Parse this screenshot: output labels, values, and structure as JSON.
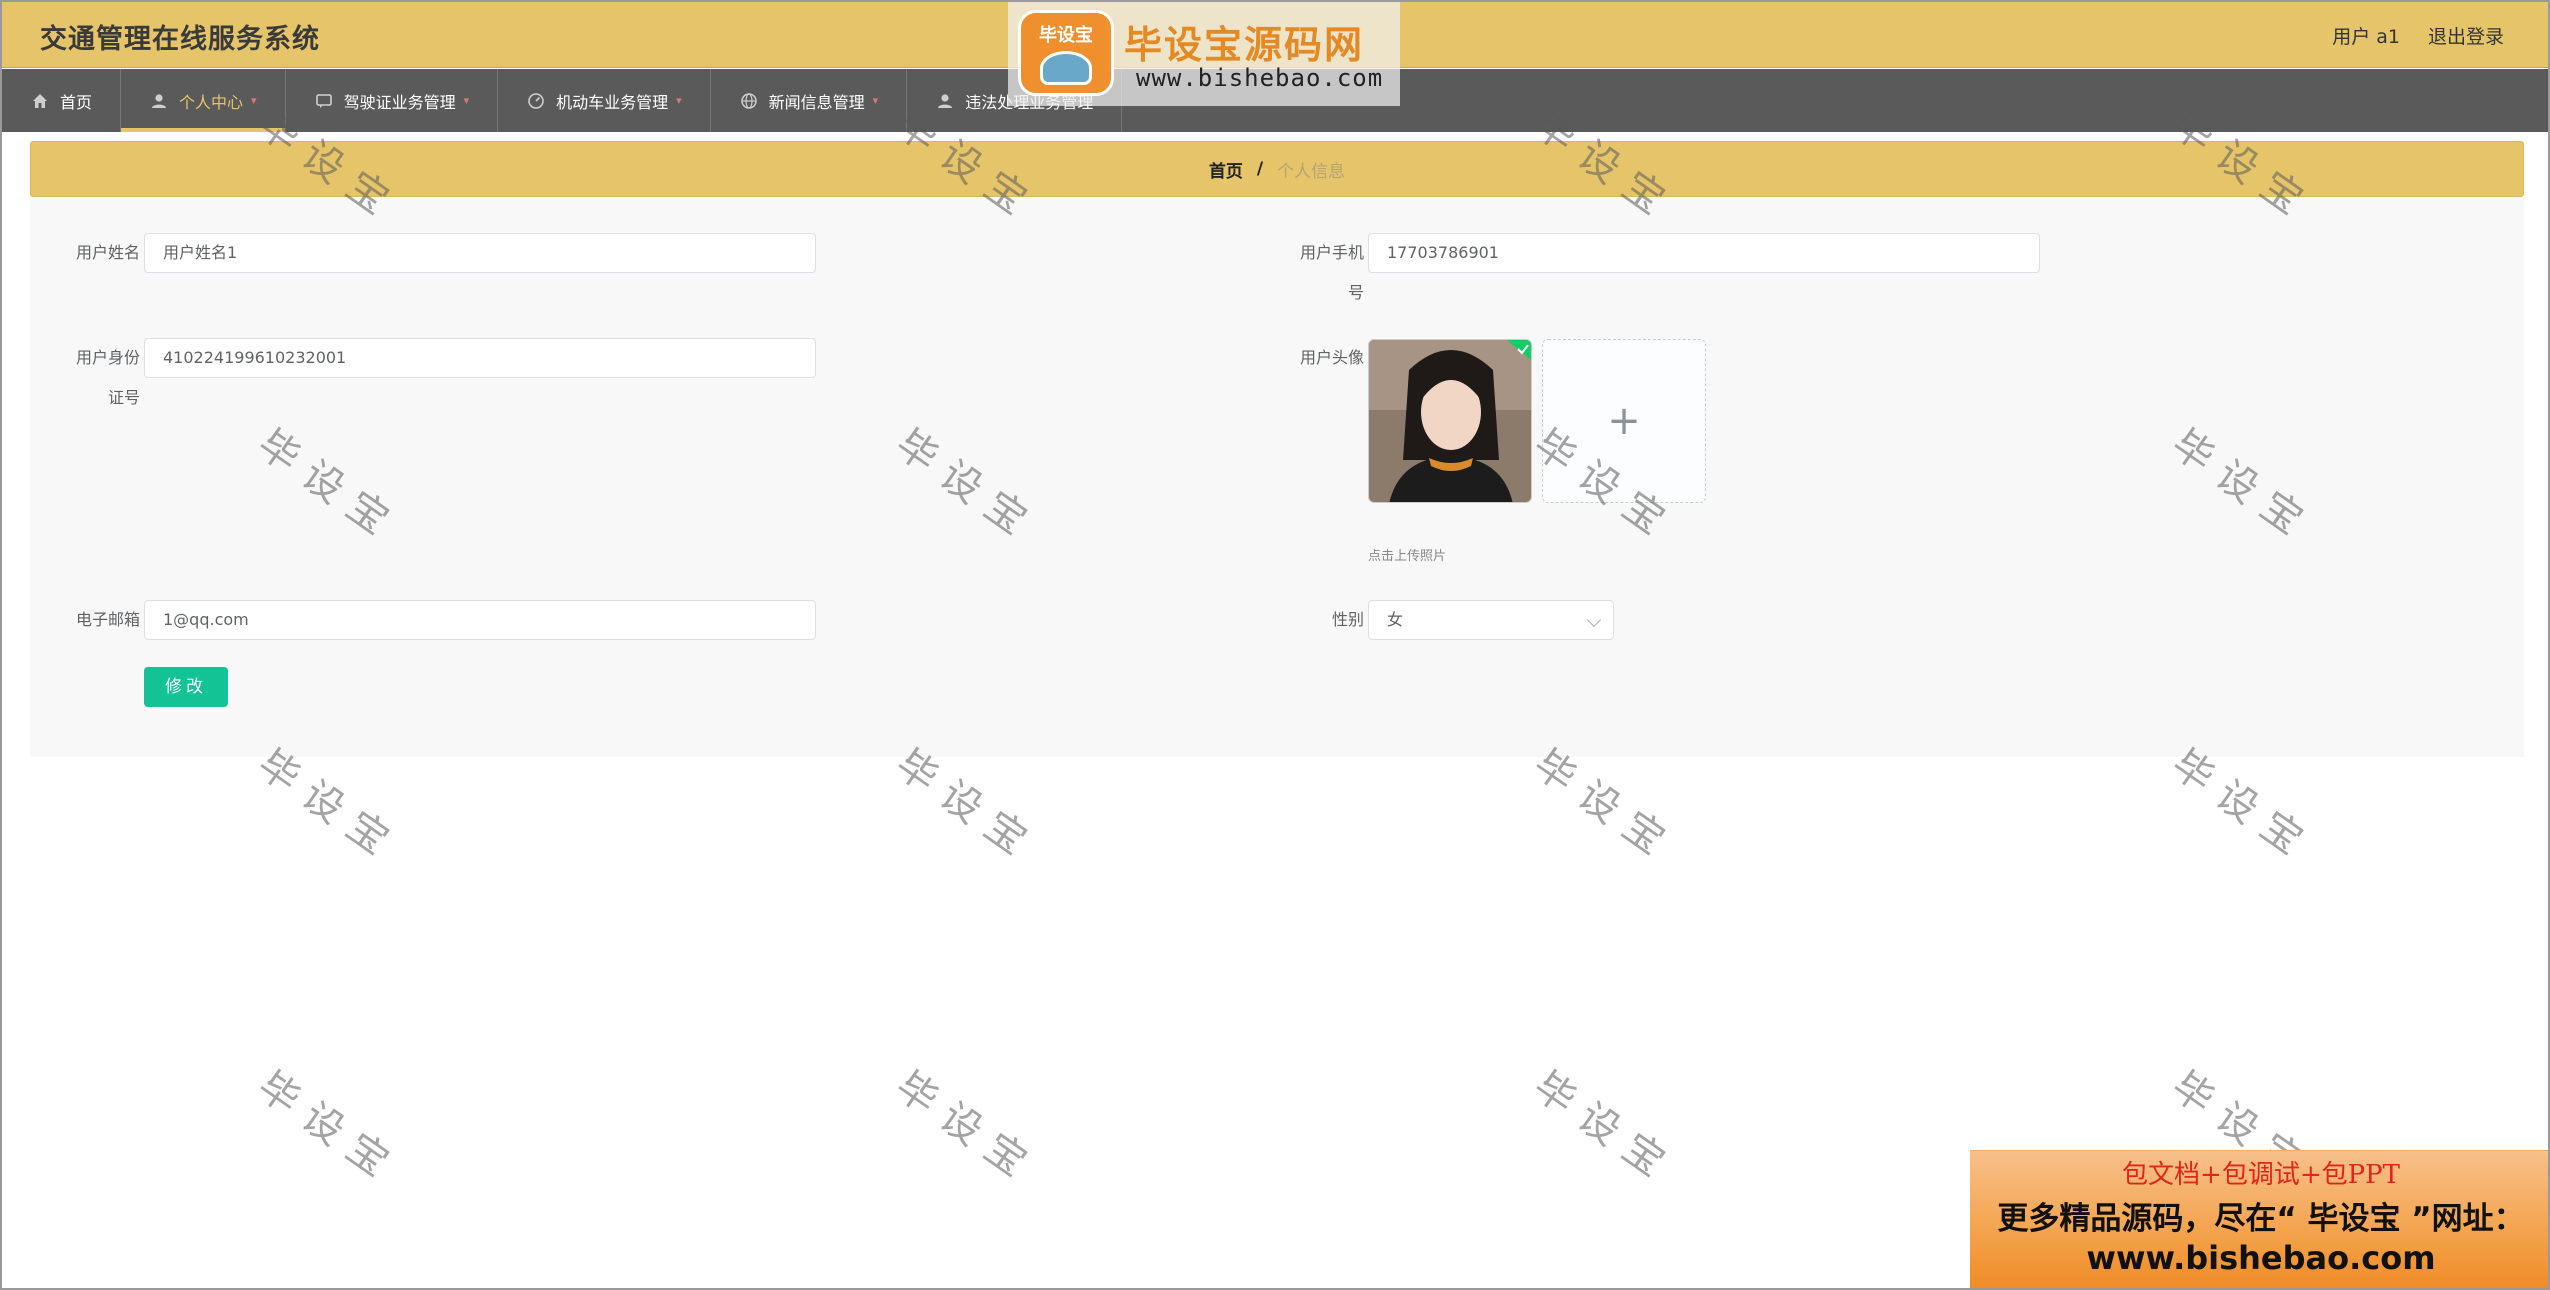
{
  "header": {
    "app_title": "交通管理在线服务系统",
    "user_label": "用户 a1",
    "logout": "退出登录"
  },
  "nav": [
    {
      "label": "首页",
      "icon": "home-icon",
      "active": false,
      "has_caret": false
    },
    {
      "label": "个人中心",
      "icon": "user-icon",
      "active": true,
      "has_caret": true
    },
    {
      "label": "驾驶证业务管理",
      "icon": "message-icon",
      "active": false,
      "has_caret": true
    },
    {
      "label": "机动车业务管理",
      "icon": "dashboard-icon",
      "active": false,
      "has_caret": true
    },
    {
      "label": "新闻信息管理",
      "icon": "globe-icon",
      "active": false,
      "has_caret": true
    },
    {
      "label": "违法处理业务管理",
      "icon": "person-icon",
      "active": false,
      "has_caret": false
    }
  ],
  "breadcrumb": {
    "home": "首页",
    "separator": "/",
    "current": "个人信息"
  },
  "form": {
    "name_label": "用户姓名",
    "name_value": "用户姓名1",
    "phone_label_1": "用户手机",
    "phone_label_2": "号",
    "phone_value": "17703786901",
    "id_label_1": "用户身份",
    "id_label_2": "证号",
    "id_value": "410224199610232001",
    "avatar_label": "用户头像",
    "upload_plus": "+",
    "upload_hint": "点击上传照片",
    "email_label": "电子邮箱",
    "email_value": "1@qq.com",
    "gender_label": "性别",
    "gender_value": "女",
    "submit": "修改"
  },
  "watermark": {
    "text": "毕设宝"
  },
  "logo": {
    "badge": "毕设宝",
    "name": "毕设宝源码网",
    "url": "www.bishebao.com"
  },
  "ad": {
    "line1": "包文档+包调试+包PPT",
    "line2": "更多精品源码，尽在“ 毕设宝 ”网址：",
    "line3": "www.bishebao.com"
  },
  "colors": {
    "accent": "#e6c56a",
    "nav_bg": "#5a5a5a",
    "button": "#13c295"
  }
}
